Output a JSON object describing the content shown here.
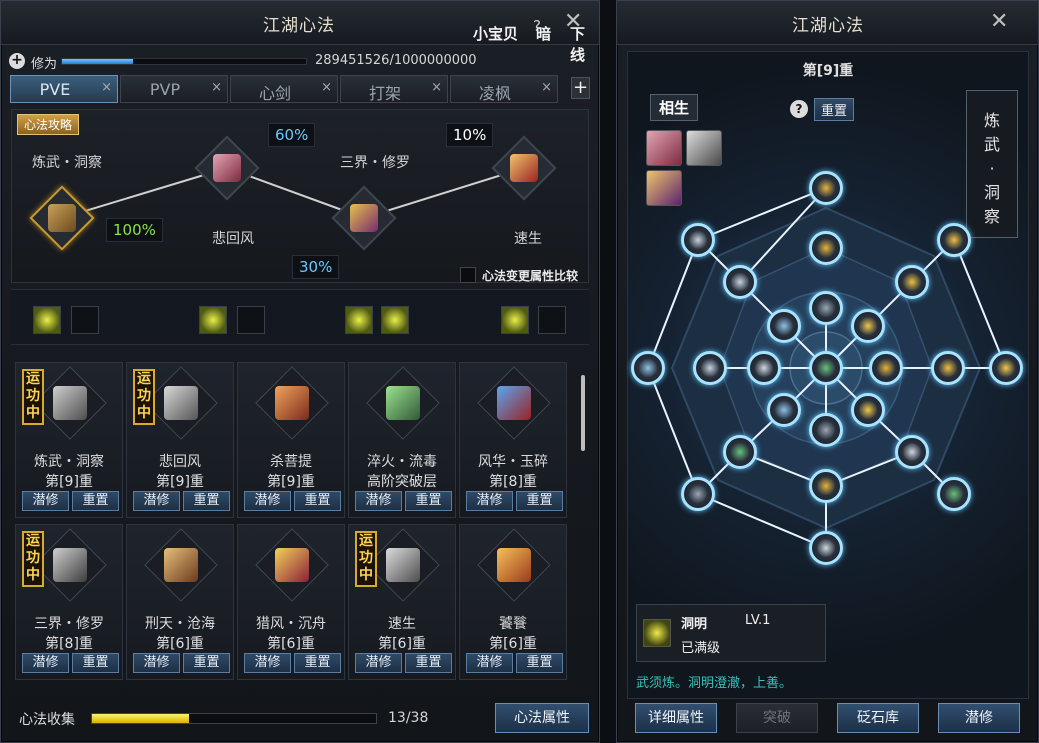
{
  "left_panel": {
    "title": "江湖心法",
    "header_links": {
      "name": "小宝贝",
      "dark": "暗",
      "offline": "下线",
      "help": "?",
      "close": "✕"
    },
    "cultivation": {
      "label": "修为",
      "value_text": "289451526/1000000000",
      "progress": 0.289
    },
    "tabs": [
      {
        "label": "PVE",
        "active": true
      },
      {
        "label": "PVP",
        "active": false
      },
      {
        "label": "心剑",
        "active": false
      },
      {
        "label": "打架",
        "active": false
      },
      {
        "label": "凌枫",
        "active": false
      }
    ],
    "tab_close": "×",
    "tab_add": "+",
    "path": {
      "guide": "心法攻略",
      "names": [
        "炼武・洞察",
        "悲回风",
        "三界・修罗",
        "速生"
      ],
      "percents": [
        "100%",
        "60%",
        "30%",
        "10%"
      ],
      "compare_label": "心法变更属性比较"
    },
    "cards": [
      {
        "name": "炼武・洞察",
        "level": "第[9]重",
        "active": true
      },
      {
        "name": "悲回风",
        "level": "第[9]重",
        "active": true
      },
      {
        "name": "杀菩提",
        "level": "第[9]重",
        "active": false
      },
      {
        "name": "淬火・流毒",
        "level": "高阶突破层",
        "active": false
      },
      {
        "name": "风华・玉碎",
        "level": "第[8]重",
        "active": false
      },
      {
        "name": "三界・修罗",
        "level": "第[8]重",
        "active": true
      },
      {
        "name": "刑天・沧海",
        "level": "第[6]重",
        "active": false
      },
      {
        "name": "猎风・沉舟",
        "level": "第[6]重",
        "active": false
      },
      {
        "name": "速生",
        "level": "第[6]重",
        "active": true
      },
      {
        "name": "饕餮",
        "level": "第[6]重",
        "active": false
      }
    ],
    "active_tag": "运功中",
    "btn_dive": "潜修",
    "btn_reset": "重置",
    "collection": {
      "label": "心法收集",
      "value_text": "13/38",
      "progress": 0.342
    },
    "attr_button": "心法属性"
  },
  "right_panel": {
    "title": "江湖心法",
    "close": "✕",
    "level": "第[9]重",
    "sub_title": "相生",
    "help": "?",
    "reset": "重置",
    "vertical_label": "炼\n武\n·\n洞\n察",
    "skill": {
      "name": "洞明",
      "level": "LV.1",
      "status": "已满级"
    },
    "description": "武须炼。洞明澄澈，上善。",
    "buttons": [
      {
        "label": "详细属性",
        "enabled": true
      },
      {
        "label": "突破",
        "enabled": false
      },
      {
        "label": "砭石库",
        "enabled": true
      },
      {
        "label": "潜修",
        "enabled": true
      }
    ]
  },
  "colors": {
    "gold": "#d9a930",
    "accent_blue": "#6ec7ff",
    "node_glow": "#a8e3ff",
    "desc_teal": "#34c5b8"
  }
}
